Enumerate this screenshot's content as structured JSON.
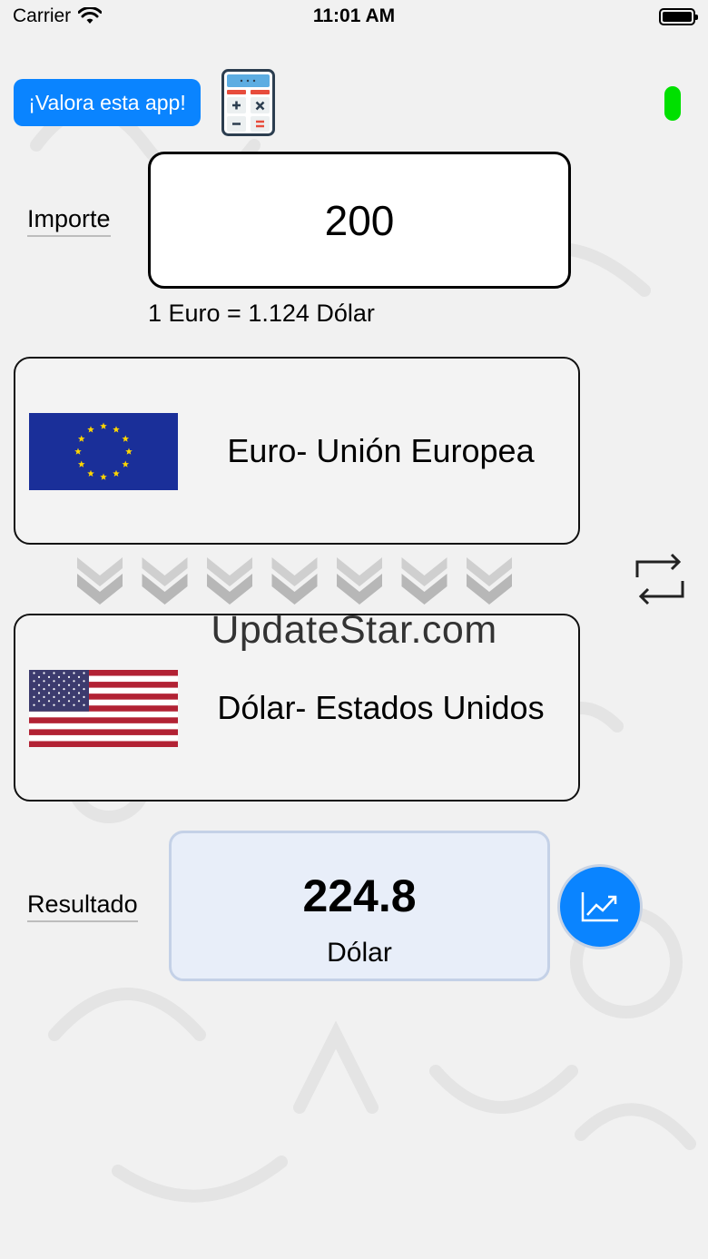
{
  "status_bar": {
    "carrier": "Carrier",
    "time": "11:01 AM"
  },
  "header": {
    "rate_app_label": "¡Valora esta app!"
  },
  "amount": {
    "label": "Importe",
    "value": "200"
  },
  "exchange_rate_text": "1 Euro = 1.124 Dólar",
  "from_currency": {
    "name": "Euro- Unión Europea",
    "flag": "eu-flag"
  },
  "to_currency": {
    "name": "Dólar- Estados Unidos",
    "flag": "us-flag"
  },
  "watermark": "UpdateStar.com",
  "result": {
    "label": "Resultado",
    "value": "224.8",
    "unit": "Dólar"
  },
  "colors": {
    "accent": "#0a84ff",
    "status_indicator": "#00e000",
    "result_bg": "#e8eef9"
  }
}
